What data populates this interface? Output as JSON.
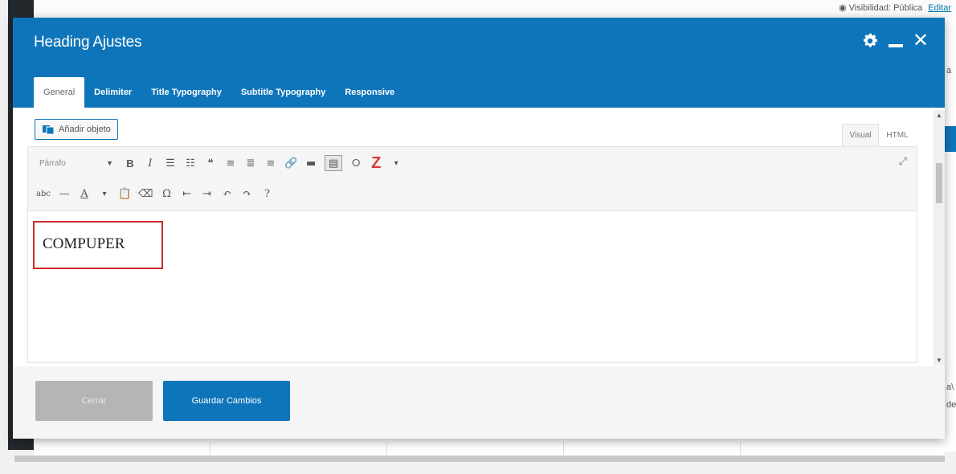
{
  "background": {
    "visibility_label": "Visibilidad: Pública",
    "visibility_link": "Editar",
    "right_fragments": [
      "a",
      "a\\",
      "de"
    ]
  },
  "modal": {
    "title": "Heading Ajustes",
    "tabs": [
      "General",
      "Delimiter",
      "Title Typography",
      "Subtitle Typography",
      "Responsive"
    ],
    "active_tab": "General"
  },
  "editor": {
    "media_button": "Añadir objeto",
    "mode_tabs": [
      "Visual",
      "HTML"
    ],
    "active_mode": "Visual",
    "format_select": "Párrafo",
    "content": "COMPUPER"
  },
  "footer": {
    "close_label": "Cerrar",
    "save_label": "Guardar Cambios"
  },
  "colors": {
    "primary": "#0e75ba",
    "highlight_border": "#cc2b2b",
    "z_icon": "#d93a3a"
  }
}
